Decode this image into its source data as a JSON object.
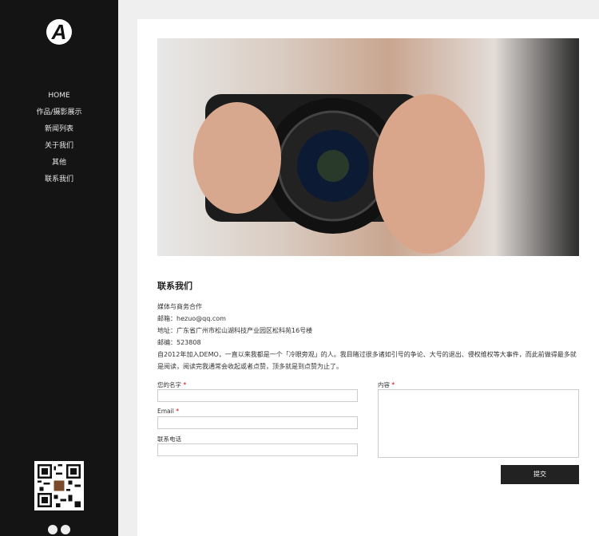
{
  "sidebar": {
    "logo": "A",
    "nav": [
      "HOME",
      "作品/摄影展示",
      "新闻列表",
      "关于我们",
      "其他",
      "联系我们"
    ],
    "social": [
      "weibo-icon",
      "qq-icon"
    ]
  },
  "main": {
    "title": "联系我们",
    "info": [
      "媒体与商务合作",
      "邮箱：hezuo@qq.com",
      "地址：广东省广州市松山湖科技产业园区松科苑16号楼",
      "邮编：523808",
      "自2012年加入DEMO，一直以来我都是一个「冷眼旁观」的人。我目睹过很多诸如引号的争论、大号的退出、侵权维权等大事件，而此前做得最多就是阅读，阅读完我通常会收起或者点赞，顶多就是到点赞为止了。"
    ],
    "form": {
      "name_label": "您的名字",
      "email_label": "Email",
      "phone_label": "联系电话",
      "content_label": "内容",
      "required": "*",
      "submit": "提交"
    }
  }
}
